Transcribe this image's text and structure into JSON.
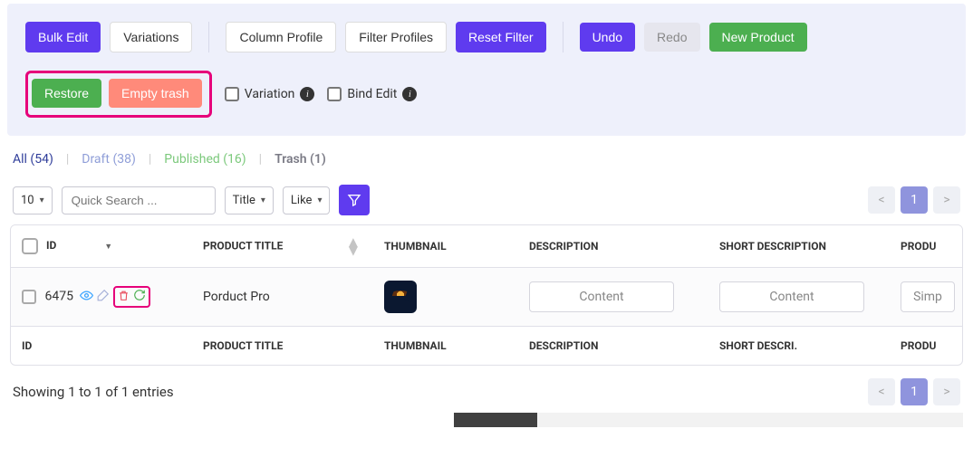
{
  "colors": {
    "accent": "#5f3bef",
    "highlight": "#e6007a",
    "success": "#4caf50",
    "salmon": "#ff8a7a"
  },
  "toolbar": {
    "bulk_edit": "Bulk Edit",
    "variations": "Variations",
    "column_profile": "Column Profile",
    "filter_profiles": "Filter Profiles",
    "reset_filter": "Reset Filter",
    "undo": "Undo",
    "redo": "Redo",
    "new_product": "New Product",
    "restore": "Restore",
    "empty_trash": "Empty trash",
    "variation_check": "Variation",
    "bind_edit_check": "Bind Edit"
  },
  "tabs": {
    "all": "All (54)",
    "draft": "Draft (38)",
    "published": "Published (16)",
    "trash": "Trash (1)"
  },
  "filters": {
    "page_size": "10",
    "search_placeholder": "Quick Search ...",
    "field_select": "Title",
    "match_select": "Like"
  },
  "table": {
    "headers": {
      "id": "ID",
      "title": "PRODUCT TITLE",
      "thumbnail": "THUMBNAIL",
      "description": "DESCRIPTION",
      "short_desc": "SHORT DESCRIPTION",
      "product": "PRODU"
    },
    "footers": {
      "id": "ID",
      "title": "PRODUCT TITLE",
      "thumbnail": "THUMBNAIL",
      "description": "DESCRIPTION",
      "short_desc": "SHORT DESCRI.",
      "product": "PRODU"
    },
    "rows": [
      {
        "id": "6475",
        "title": "Porduct Pro",
        "desc_btn": "Content",
        "short_btn": "Content",
        "product_btn": "Simp"
      }
    ]
  },
  "pagination": {
    "prev": "<",
    "current": "1",
    "next": ">"
  },
  "entries_text": "Showing 1 to 1 of 1 entries"
}
